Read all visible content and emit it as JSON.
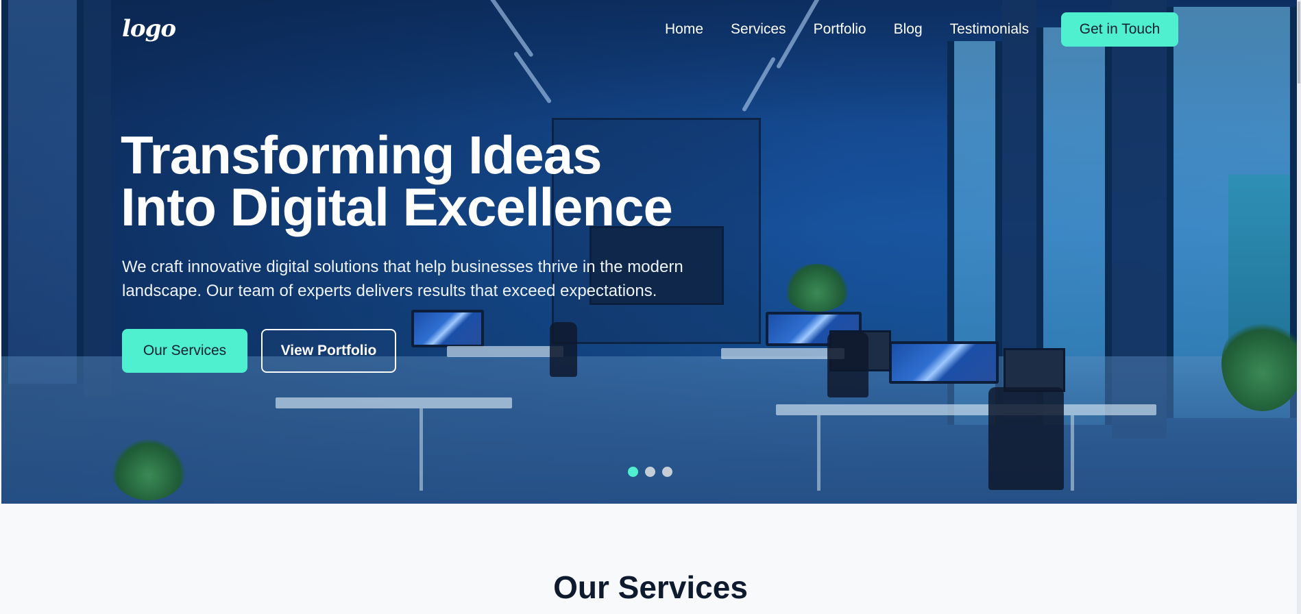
{
  "nav": {
    "logo": "logo",
    "items": [
      {
        "label": "Home"
      },
      {
        "label": "Services"
      },
      {
        "label": "Portfolio"
      },
      {
        "label": "Blog"
      },
      {
        "label": "Testimonials"
      }
    ],
    "cta": "Get in Touch"
  },
  "hero": {
    "title_line1": "Transforming Ideas",
    "title_line2": "Into Digital Excellence",
    "subtitle": "We craft innovative digital solutions that help businesses thrive in the modern landscape. Our team of experts delivers results that exceed expectations.",
    "primary_button": "Our Services",
    "secondary_button": "View Portfolio",
    "carousel": {
      "slides": 3,
      "active_index": 0
    }
  },
  "services": {
    "title": "Our Services"
  },
  "colors": {
    "accent": "#4ef0cf",
    "hero_overlay": "#0f3a78",
    "text_dark": "#0e1a2e"
  }
}
